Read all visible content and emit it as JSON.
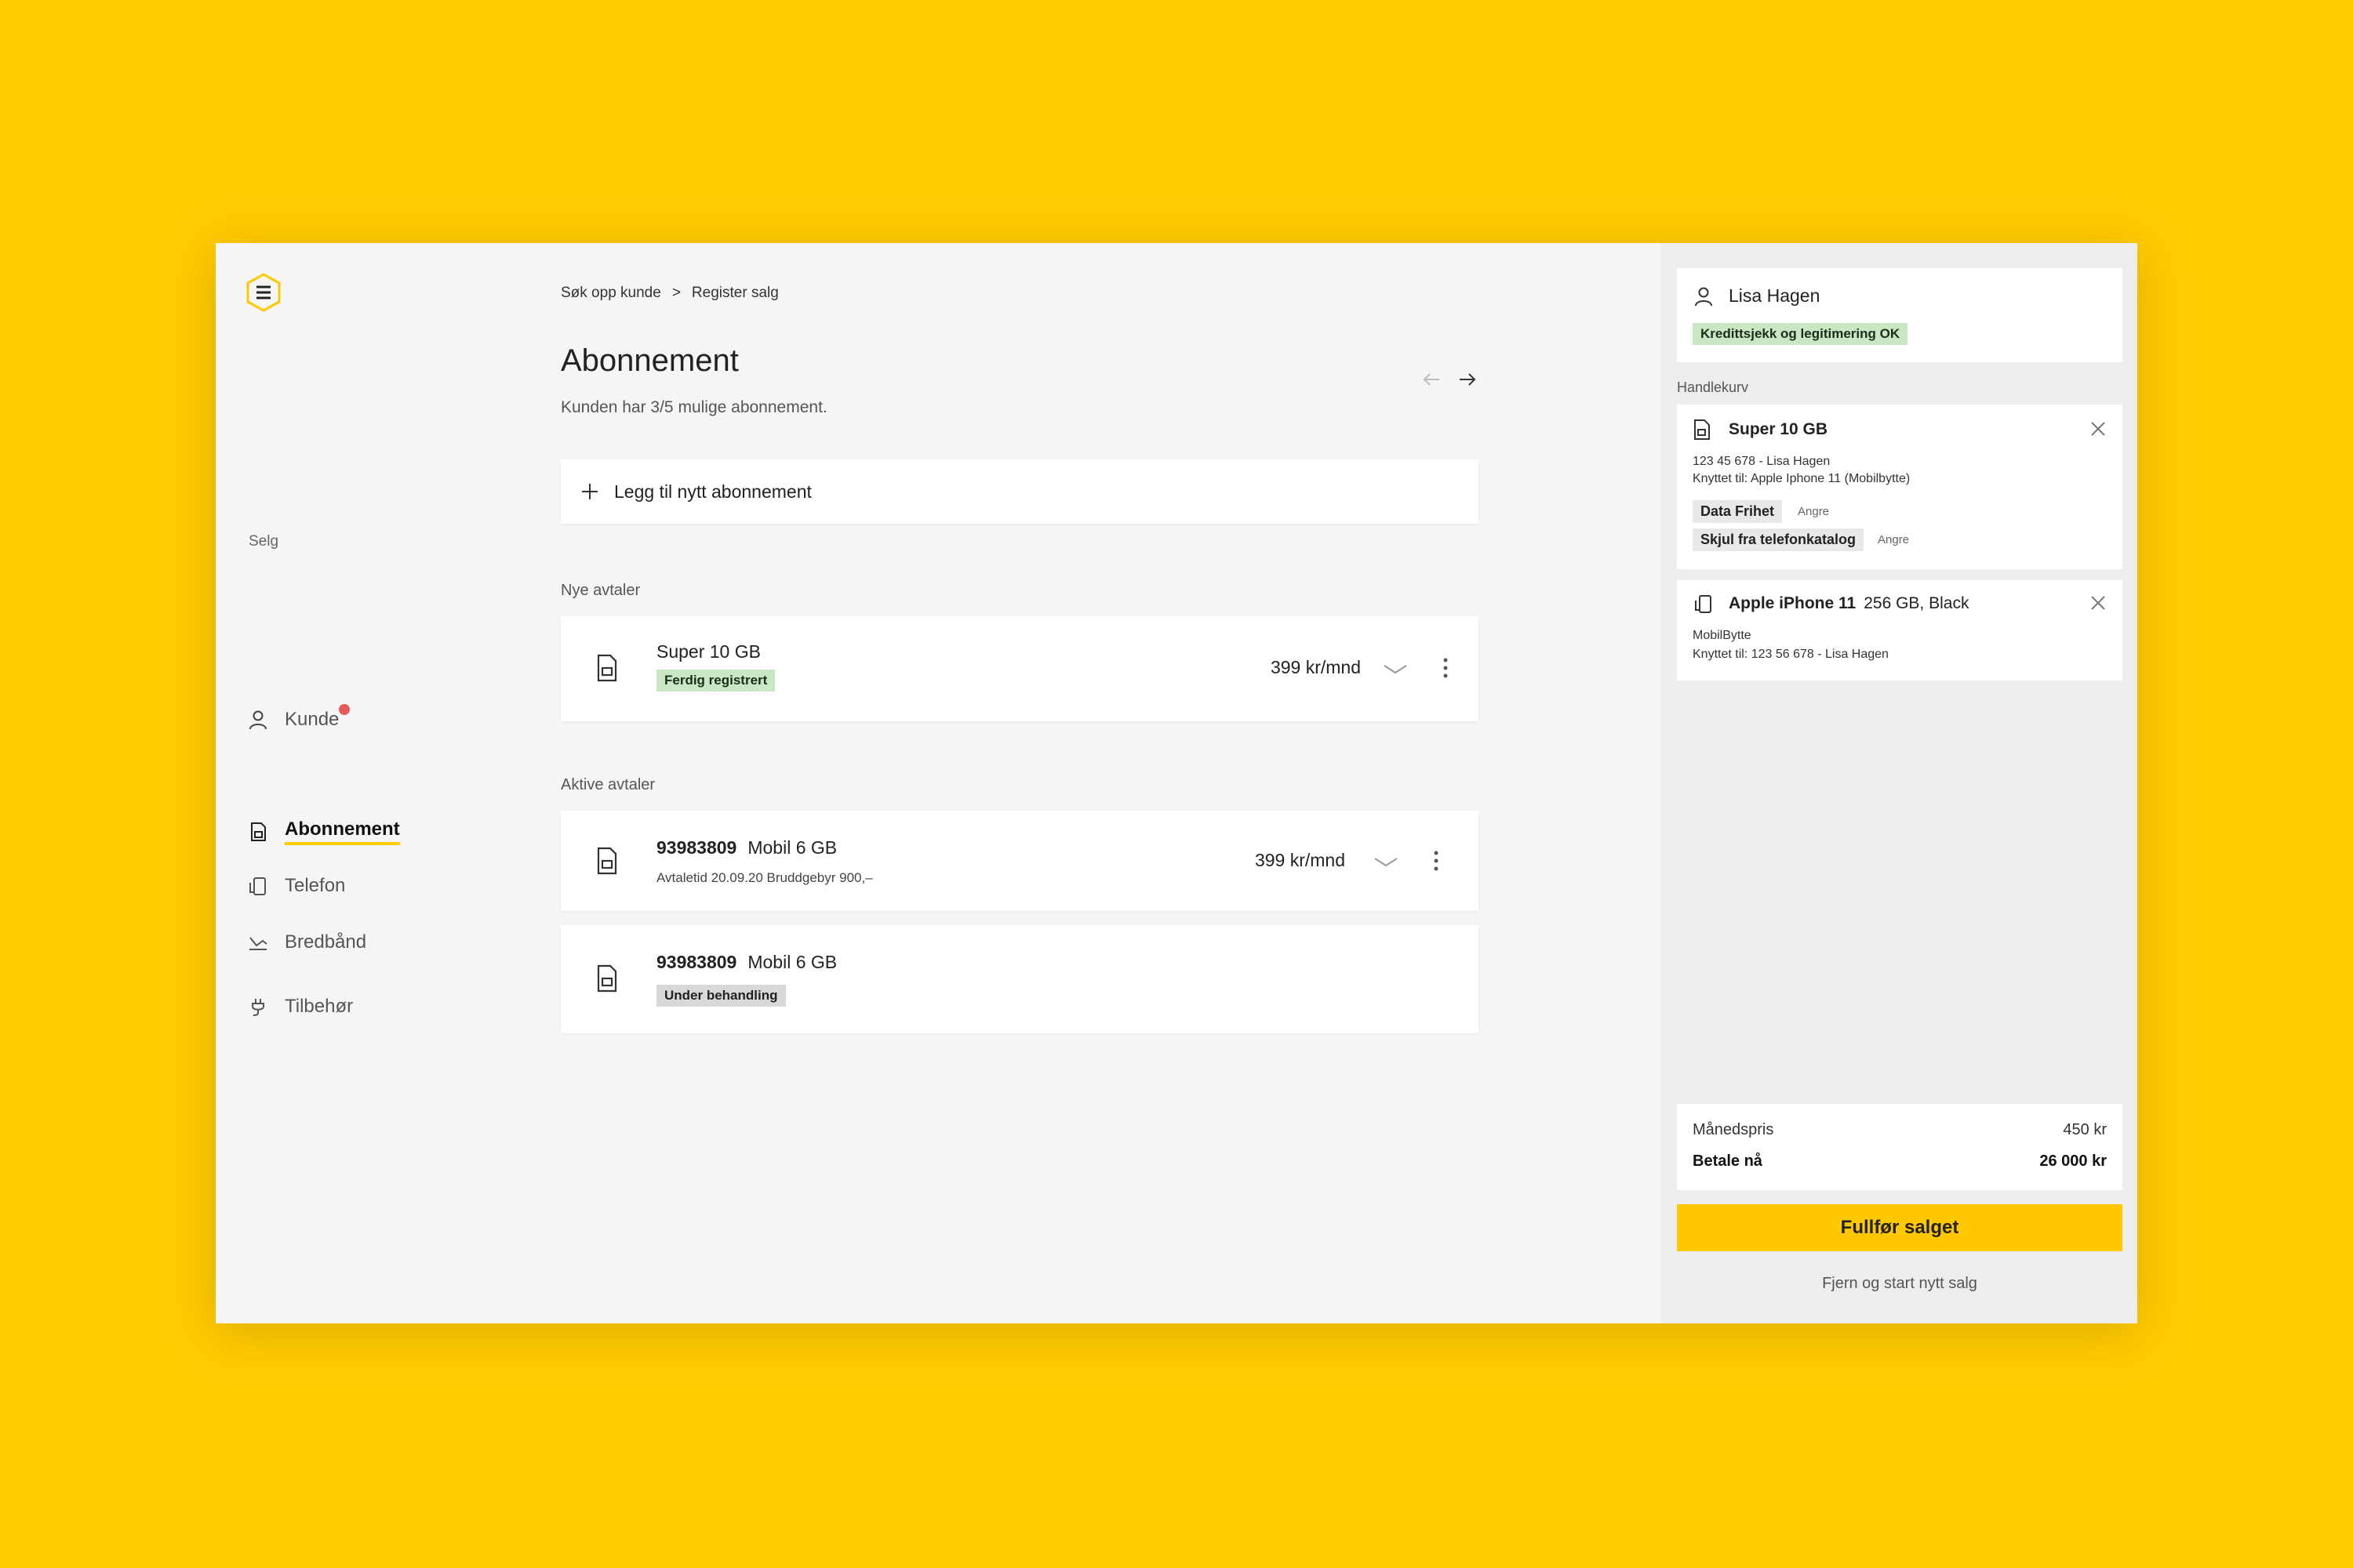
{
  "nav": {
    "customer_label": "Kunde",
    "section_label": "Selg",
    "items": [
      {
        "label": "Abonnement"
      },
      {
        "label": "Telefon"
      },
      {
        "label": "Bredbånd"
      },
      {
        "label": "Tilbehør"
      }
    ]
  },
  "breadcrumb": {
    "first": "Søk opp kunde",
    "separator": ">",
    "second": "Register salg"
  },
  "page": {
    "title": "Abonnement",
    "subtitle": "Kunden har 3/5 mulige abonnement.",
    "add_label": "Legg til nytt abonnement"
  },
  "new_agreements": {
    "label": "Nye avtaler",
    "items": [
      {
        "title": "Super 10 GB",
        "badge": "Ferdig registrert",
        "price": "399 kr/mnd"
      }
    ]
  },
  "active_agreements": {
    "label": "Aktive avtaler",
    "items": [
      {
        "number": "93983809",
        "plan": "Mobil 6 GB",
        "meta": "Avtaletid 20.09.20  Bruddgebyr 900,–",
        "price": "399 kr/mnd"
      },
      {
        "number": "93983809",
        "plan": "Mobil 6 GB",
        "badge": "Under behandling"
      }
    ]
  },
  "panel": {
    "customer_name": "Lisa Hagen",
    "credit_badge": "Kredittsjekk og legitimering OK",
    "cart_label": "Handlekurv",
    "cart": [
      {
        "title": "Super 10 GB",
        "line1": "123 45 678 - Lisa Hagen",
        "line2": "Knyttet til: Apple Iphone 11 (Mobilbytte)",
        "tags": [
          {
            "label": "Data Frihet",
            "undo": "Angre"
          },
          {
            "label": "Skjul fra telefonkatalog",
            "undo": "Angre"
          }
        ]
      },
      {
        "title": "Apple iPhone 11",
        "variant": "256 GB, Black",
        "line1": "MobilBytte",
        "line2": "Knyttet til: 123 56 678 - Lisa Hagen"
      }
    ],
    "summary": {
      "monthly_label": "Månedspris",
      "monthly_value": "450 kr",
      "pay_now_label": "Betale nå",
      "pay_now_value": "26 000 kr"
    },
    "cta_label": "Fullfør salget",
    "reset_label": "Fjern og start nytt salg"
  },
  "colors": {
    "brand": "#FFCC00",
    "success_badge": "#c9e7c2",
    "notification_dot": "#e85a5a"
  }
}
